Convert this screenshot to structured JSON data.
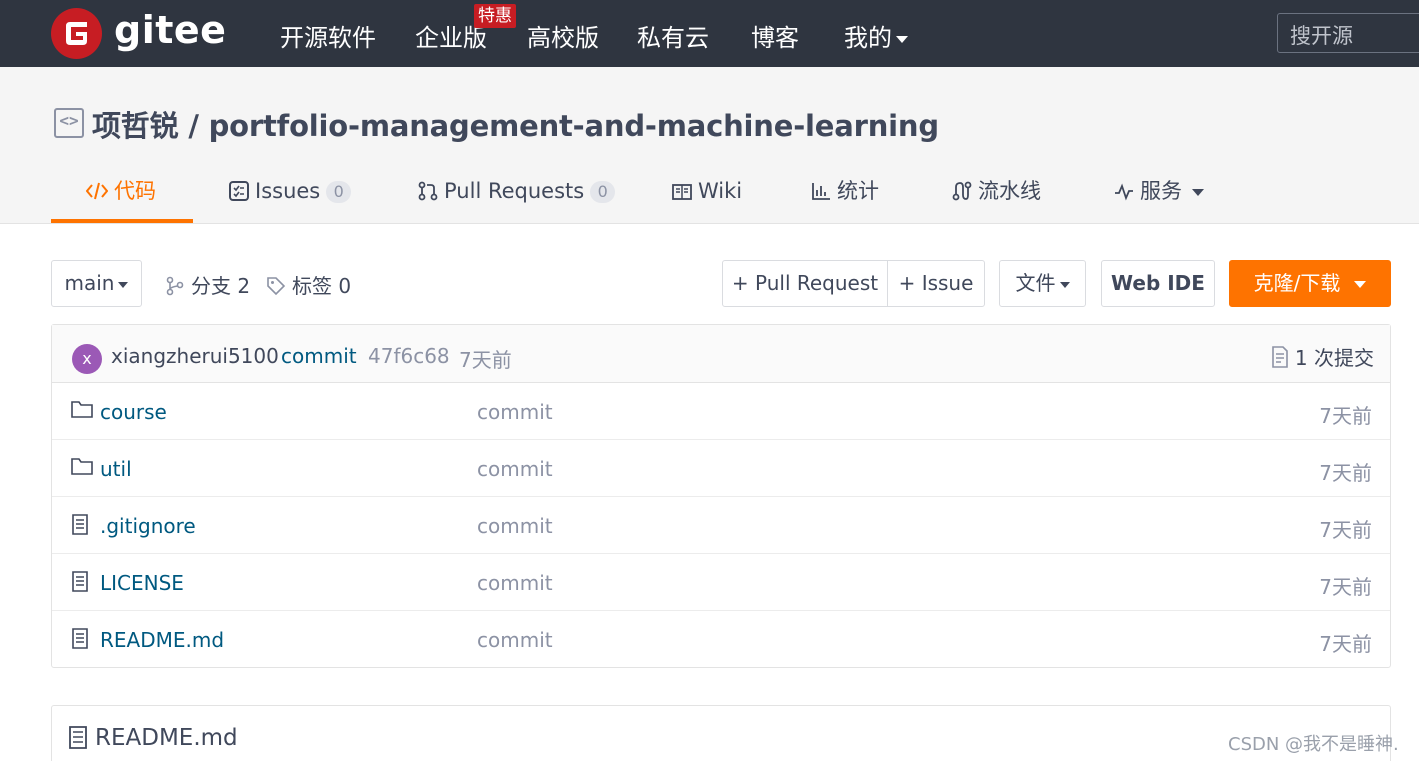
{
  "nav": {
    "logo": "gitee",
    "items": [
      "开源软件",
      "企业版",
      "高校版",
      "私有云",
      "博客",
      "我的"
    ],
    "badge": "特惠",
    "search_placeholder": "搜开源"
  },
  "repo": {
    "owner": "项哲锐",
    "separator": "/",
    "name": "portfolio-management-and-machine-learning"
  },
  "tabs": [
    {
      "label": "代码",
      "icon": "code-icon"
    },
    {
      "label": "Issues",
      "count": "0",
      "icon": "issues-icon"
    },
    {
      "label": "Pull Requests",
      "count": "0",
      "icon": "pull-request-icon"
    },
    {
      "label": "Wiki",
      "icon": "wiki-book-icon"
    },
    {
      "label": "统计",
      "icon": "stats-bar-icon"
    },
    {
      "label": "流水线",
      "icon": "pipeline-icon"
    },
    {
      "label": "服务",
      "icon": "service-pulse-icon"
    }
  ],
  "toolbar": {
    "branch": "main",
    "branches_label": "分支 2",
    "tags_label": "标签 0",
    "pull_request_btn": "+ Pull Request",
    "issue_btn": "+ Issue",
    "file_btn": "文件",
    "web_ide_btn": "Web IDE",
    "clone_btn": "克隆/下载"
  },
  "latest_commit": {
    "avatar_letter": "x",
    "author": "xiangzherui5100",
    "message": "commit",
    "hash": "47f6c68",
    "time": "7天前",
    "count_label": "1 次提交"
  },
  "files": [
    {
      "type": "folder",
      "name": "course",
      "message": "commit",
      "time": "7天前"
    },
    {
      "type": "folder",
      "name": "util",
      "message": "commit",
      "time": "7天前"
    },
    {
      "type": "file",
      "name": ".gitignore",
      "message": "commit",
      "time": "7天前"
    },
    {
      "type": "file",
      "name": "LICENSE",
      "message": "commit",
      "time": "7天前"
    },
    {
      "type": "file",
      "name": "README.md",
      "message": "commit",
      "time": "7天前"
    }
  ],
  "readme": {
    "title": "README.md"
  },
  "watermark": "CSDN @我不是睡神.",
  "colors": {
    "nav_bg": "#2f3540",
    "brand_red": "#c71d23",
    "accent_orange": "#fe7300",
    "link_blue": "#005980"
  }
}
